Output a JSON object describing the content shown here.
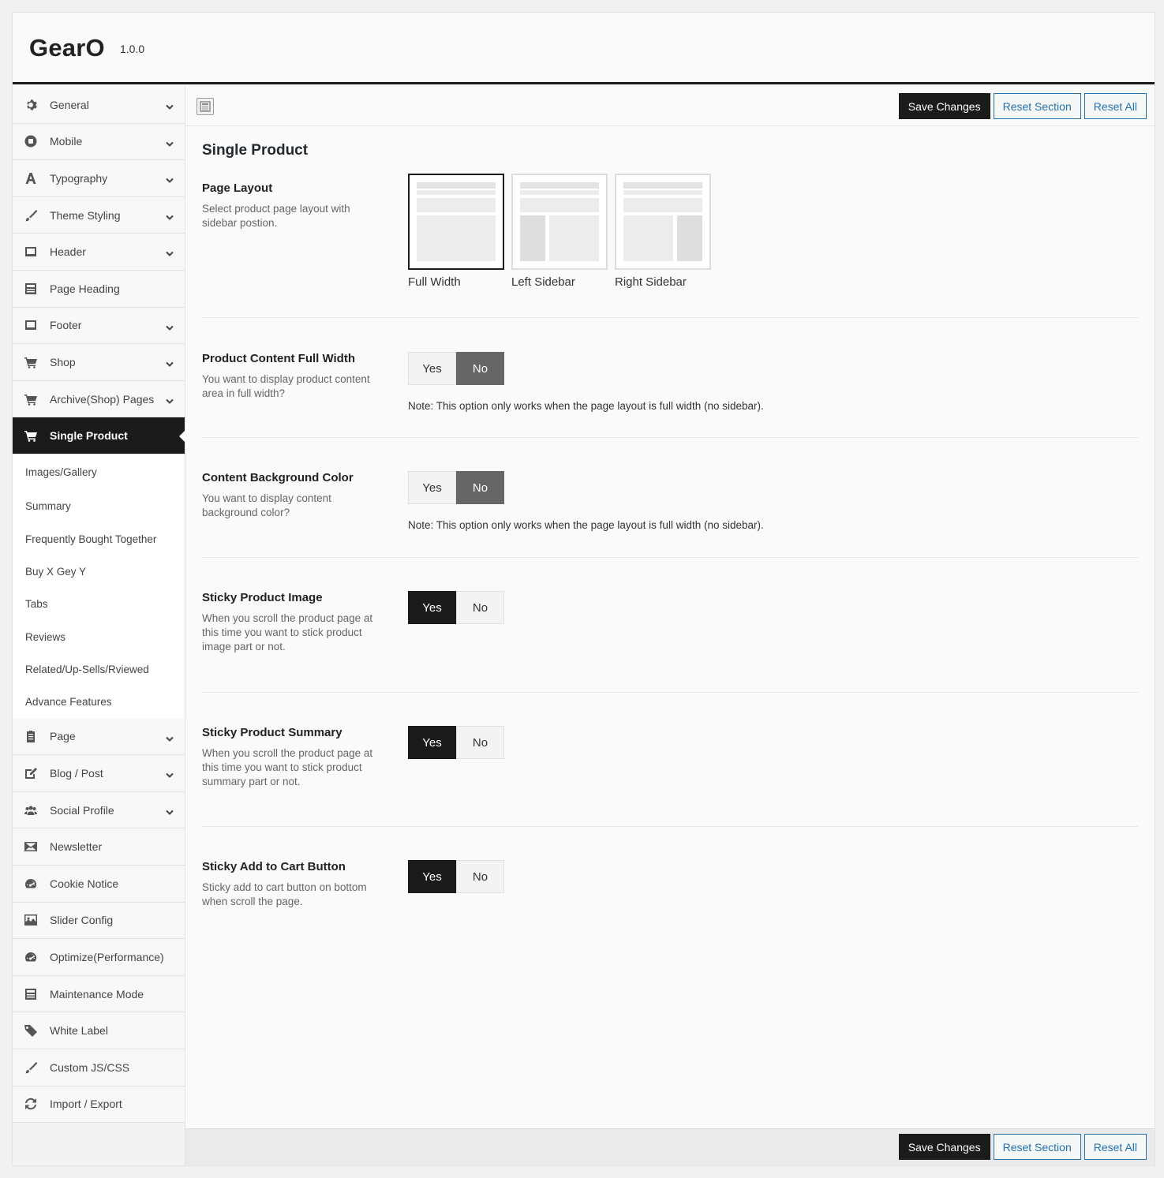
{
  "app": {
    "name": "GearO",
    "version": "1.0.0"
  },
  "toolbar": {
    "save": "Save Changes",
    "reset_section": "Reset Section",
    "reset_all": "Reset All"
  },
  "sidebar": {
    "items_top": [
      {
        "label": "General",
        "icon": "gear-icon",
        "chevron": true
      },
      {
        "label": "Mobile",
        "icon": "mobile-icon",
        "chevron": true
      },
      {
        "label": "Typography",
        "icon": "font-icon",
        "chevron": true
      },
      {
        "label": "Theme Styling",
        "icon": "brush-icon",
        "chevron": true
      },
      {
        "label": "Header",
        "icon": "header-icon",
        "chevron": true
      },
      {
        "label": "Page Heading",
        "icon": "page-heading-icon",
        "chevron": false
      },
      {
        "label": "Footer",
        "icon": "footer-icon",
        "chevron": true
      },
      {
        "label": "Shop",
        "icon": "cart-icon",
        "chevron": true
      },
      {
        "label": "Archive(Shop) Pages",
        "icon": "cart-icon",
        "chevron": true
      },
      {
        "label": "Single Product",
        "icon": "cart-icon",
        "chevron": false,
        "active": true
      }
    ],
    "sub_items": [
      "Images/Gallery",
      "Summary",
      "Frequently Bought Together",
      "Buy X Gey Y",
      "Tabs",
      "Reviews",
      "Related/Up-Sells/Rviewed",
      "Advance Features"
    ],
    "items_bottom": [
      {
        "label": "Page",
        "icon": "clipboard-icon",
        "chevron": true
      },
      {
        "label": "Blog / Post",
        "icon": "edit-icon",
        "chevron": true
      },
      {
        "label": "Social Profile",
        "icon": "users-icon",
        "chevron": true
      },
      {
        "label": "Newsletter",
        "icon": "envelope-icon",
        "chevron": false
      },
      {
        "label": "Cookie Notice",
        "icon": "dashboard-icon",
        "chevron": false
      },
      {
        "label": "Slider Config",
        "icon": "image-icon",
        "chevron": false
      },
      {
        "label": "Optimize(Performance)",
        "icon": "dashboard-icon",
        "chevron": false
      },
      {
        "label": "Maintenance Mode",
        "icon": "page-heading-icon",
        "chevron": false
      },
      {
        "label": "White Label",
        "icon": "tag-icon",
        "chevron": false
      },
      {
        "label": "Custom JS/CSS",
        "icon": "brush-icon",
        "chevron": false
      },
      {
        "label": "Import / Export",
        "icon": "refresh-icon",
        "chevron": false
      }
    ]
  },
  "section": {
    "title": "Single Product",
    "page_layout": {
      "label": "Page Layout",
      "desc": "Select product page layout with sidebar postion.",
      "options": [
        "Full Width",
        "Left Sidebar",
        "Right Sidebar"
      ],
      "selected": "Full Width"
    },
    "fields": [
      {
        "label": "Product Content Full Width",
        "desc": "You want to display product content area in full width?",
        "yes": "Yes",
        "no": "No",
        "value": "No",
        "note": "Note: This option only works when the page layout is full width (no sidebar)."
      },
      {
        "label": "Content Background Color",
        "desc": "You want to display content background color?",
        "yes": "Yes",
        "no": "No",
        "value": "No",
        "note": "Note: This option only works when the page layout is full width (no sidebar)."
      },
      {
        "label": "Sticky Product Image",
        "desc": "When you scroll the product page at this time you want to stick product image part or not.",
        "yes": "Yes",
        "no": "No",
        "value": "Yes",
        "note": ""
      },
      {
        "label": "Sticky Product Summary",
        "desc": "When you scroll the product page at this time you want to stick product summary part or not.",
        "yes": "Yes",
        "no": "No",
        "value": "Yes",
        "note": ""
      },
      {
        "label": "Sticky Add to Cart Button",
        "desc": "Sticky add to cart button on bottom when scroll the page.",
        "yes": "Yes",
        "no": "No",
        "value": "Yes",
        "note": ""
      }
    ]
  }
}
